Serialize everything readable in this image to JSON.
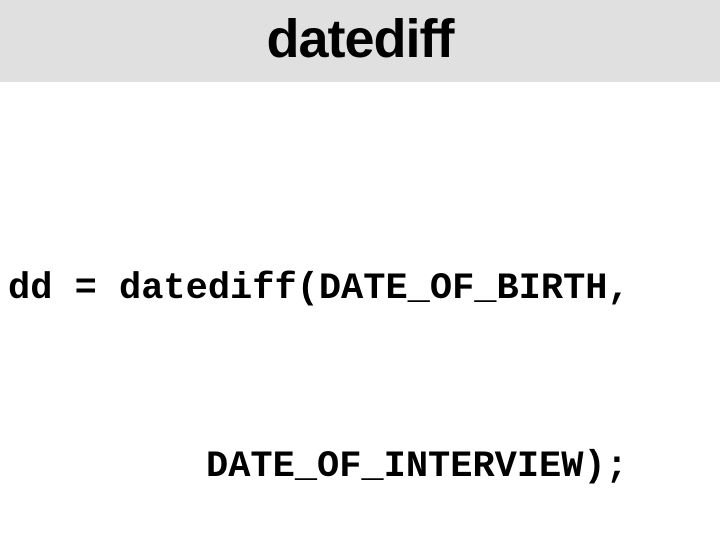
{
  "header": {
    "title": "datediff"
  },
  "code": {
    "line1": "dd = datediff(DATE_OF_BIRTH,",
    "line2": "DATE_OF_INTERVIEW);"
  }
}
